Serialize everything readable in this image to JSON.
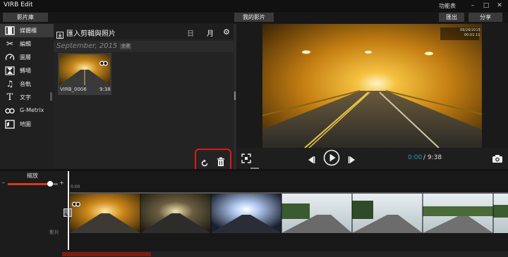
{
  "app": {
    "title": "VIRB Edit",
    "menu_label": "功能表",
    "minimize": "–",
    "restore": "□",
    "close": "✕"
  },
  "tabs": {
    "library": "影片庫",
    "my_videos": "我的影片",
    "export": "匯出",
    "share": "分享"
  },
  "sidebar": {
    "items": [
      {
        "label": "媒體櫃",
        "icon": "film-icon"
      },
      {
        "label": "編輯",
        "icon": "scissors-icon"
      },
      {
        "label": "圖層",
        "icon": "gauge-icon"
      },
      {
        "label": "轉場",
        "icon": "hourglass-icon"
      },
      {
        "label": "音軌",
        "icon": "music-note-icon"
      },
      {
        "label": "文字",
        "icon": "text-t-icon"
      },
      {
        "label": "G-Metrix",
        "icon": "gmetrix-icon"
      },
      {
        "label": "地圖",
        "icon": "map-icon"
      }
    ]
  },
  "media": {
    "import_label": "匯入剪輯與照片",
    "view_day": "日",
    "view_month": "月",
    "date_group": "September, 2015",
    "date_badge": "全選",
    "clip": {
      "name": "VIRB_0006",
      "duration": "9:38"
    }
  },
  "preview": {
    "overlay_date": "09/26/2015",
    "overlay_time": "00:01:11",
    "time_current": "0:00",
    "time_total": "/ 9:38"
  },
  "timeline": {
    "zoom_label": "縮放",
    "zoom_minus": "–",
    "zoom_plus": "+",
    "zoom_level": 0.85,
    "ruler_start": "0:00",
    "track_label": "影片"
  },
  "colors": {
    "accent_red": "#e01818",
    "time_teal": "#2a9aa8",
    "scroll_thumb": "#7a1e0e",
    "slider_red": "#d93a1a"
  }
}
